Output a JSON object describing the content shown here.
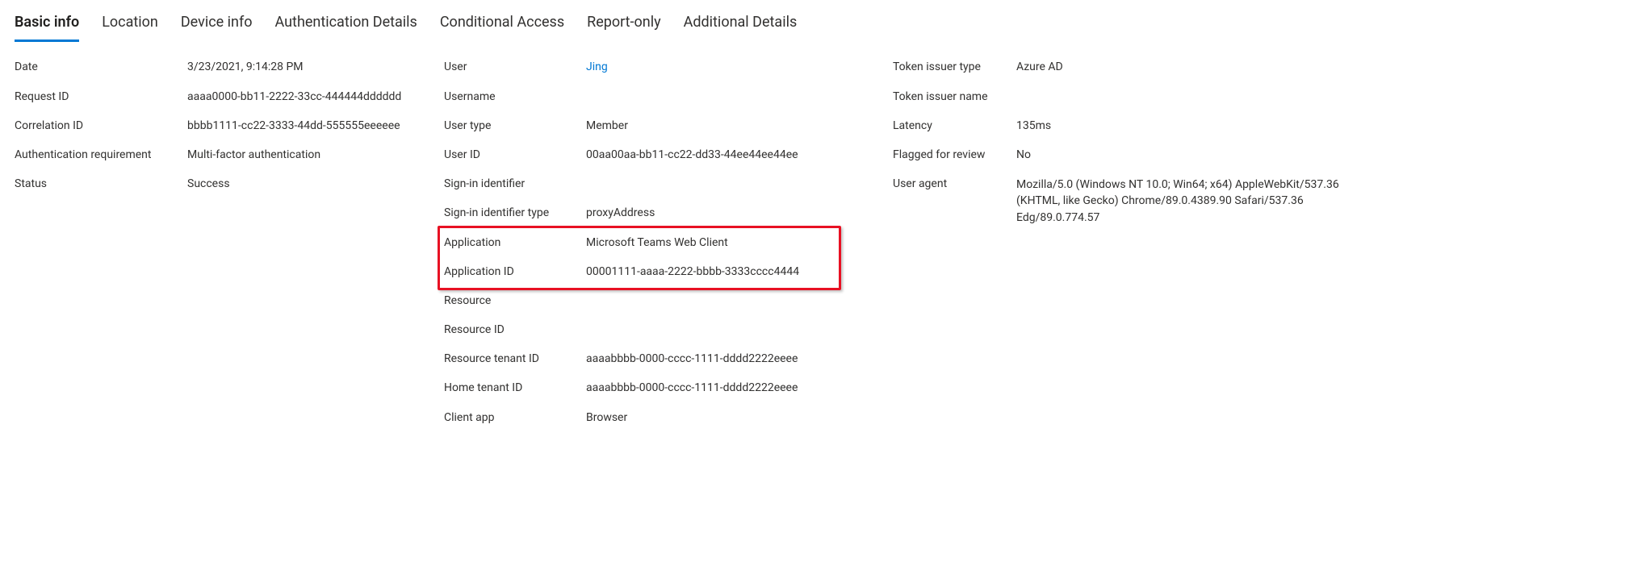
{
  "tabs": {
    "basic_info": "Basic info",
    "location": "Location",
    "device_info": "Device info",
    "auth_details": "Authentication Details",
    "conditional_access": "Conditional Access",
    "report_only": "Report-only",
    "additional_details": "Additional Details"
  },
  "col1": {
    "date_label": "Date",
    "date_value": "3/23/2021, 9:14:28 PM",
    "request_id_label": "Request ID",
    "request_id_value": "aaaa0000-bb11-2222-33cc-444444dddddd",
    "correlation_id_label": "Correlation ID",
    "correlation_id_value": "bbbb1111-cc22-3333-44dd-555555eeeeee",
    "auth_req_label": "Authentication requirement",
    "auth_req_value": "Multi-factor authentication",
    "status_label": "Status",
    "status_value": "Success"
  },
  "col2": {
    "user_label": "User",
    "user_value": "Jing",
    "username_label": "Username",
    "username_value": "",
    "user_type_label": "User type",
    "user_type_value": "Member",
    "user_id_label": "User ID",
    "user_id_value": "00aa00aa-bb11-cc22-dd33-44ee44ee44ee",
    "signin_id_label": "Sign-in identifier",
    "signin_id_value": "",
    "signin_id_type_label": "Sign-in identifier type",
    "signin_id_type_value": "proxyAddress",
    "application_label": "Application",
    "application_value": "Microsoft Teams Web Client",
    "application_id_label": "Application ID",
    "application_id_value": "00001111-aaaa-2222-bbbb-3333cccc4444",
    "resource_label": "Resource",
    "resource_value": "",
    "resource_id_label": "Resource ID",
    "resource_id_value": "",
    "resource_tenant_id_label": "Resource tenant ID",
    "resource_tenant_id_value": "aaaabbbb-0000-cccc-1111-dddd2222eeee",
    "home_tenant_id_label": "Home tenant ID",
    "home_tenant_id_value": "aaaabbbb-0000-cccc-1111-dddd2222eeee",
    "client_app_label": "Client app",
    "client_app_value": "Browser"
  },
  "col3": {
    "token_issuer_type_label": "Token issuer type",
    "token_issuer_type_value": "Azure AD",
    "token_issuer_name_label": "Token issuer name",
    "token_issuer_name_value": "",
    "latency_label": "Latency",
    "latency_value": "135ms",
    "flagged_label": "Flagged for review",
    "flagged_value": "No",
    "user_agent_label": "User agent",
    "user_agent_value": "Mozilla/5.0 (Windows NT 10.0; Win64; x64) AppleWebKit/537.36 (KHTML, like Gecko) Chrome/89.0.4389.90 Safari/537.36 Edg/89.0.774.57"
  }
}
